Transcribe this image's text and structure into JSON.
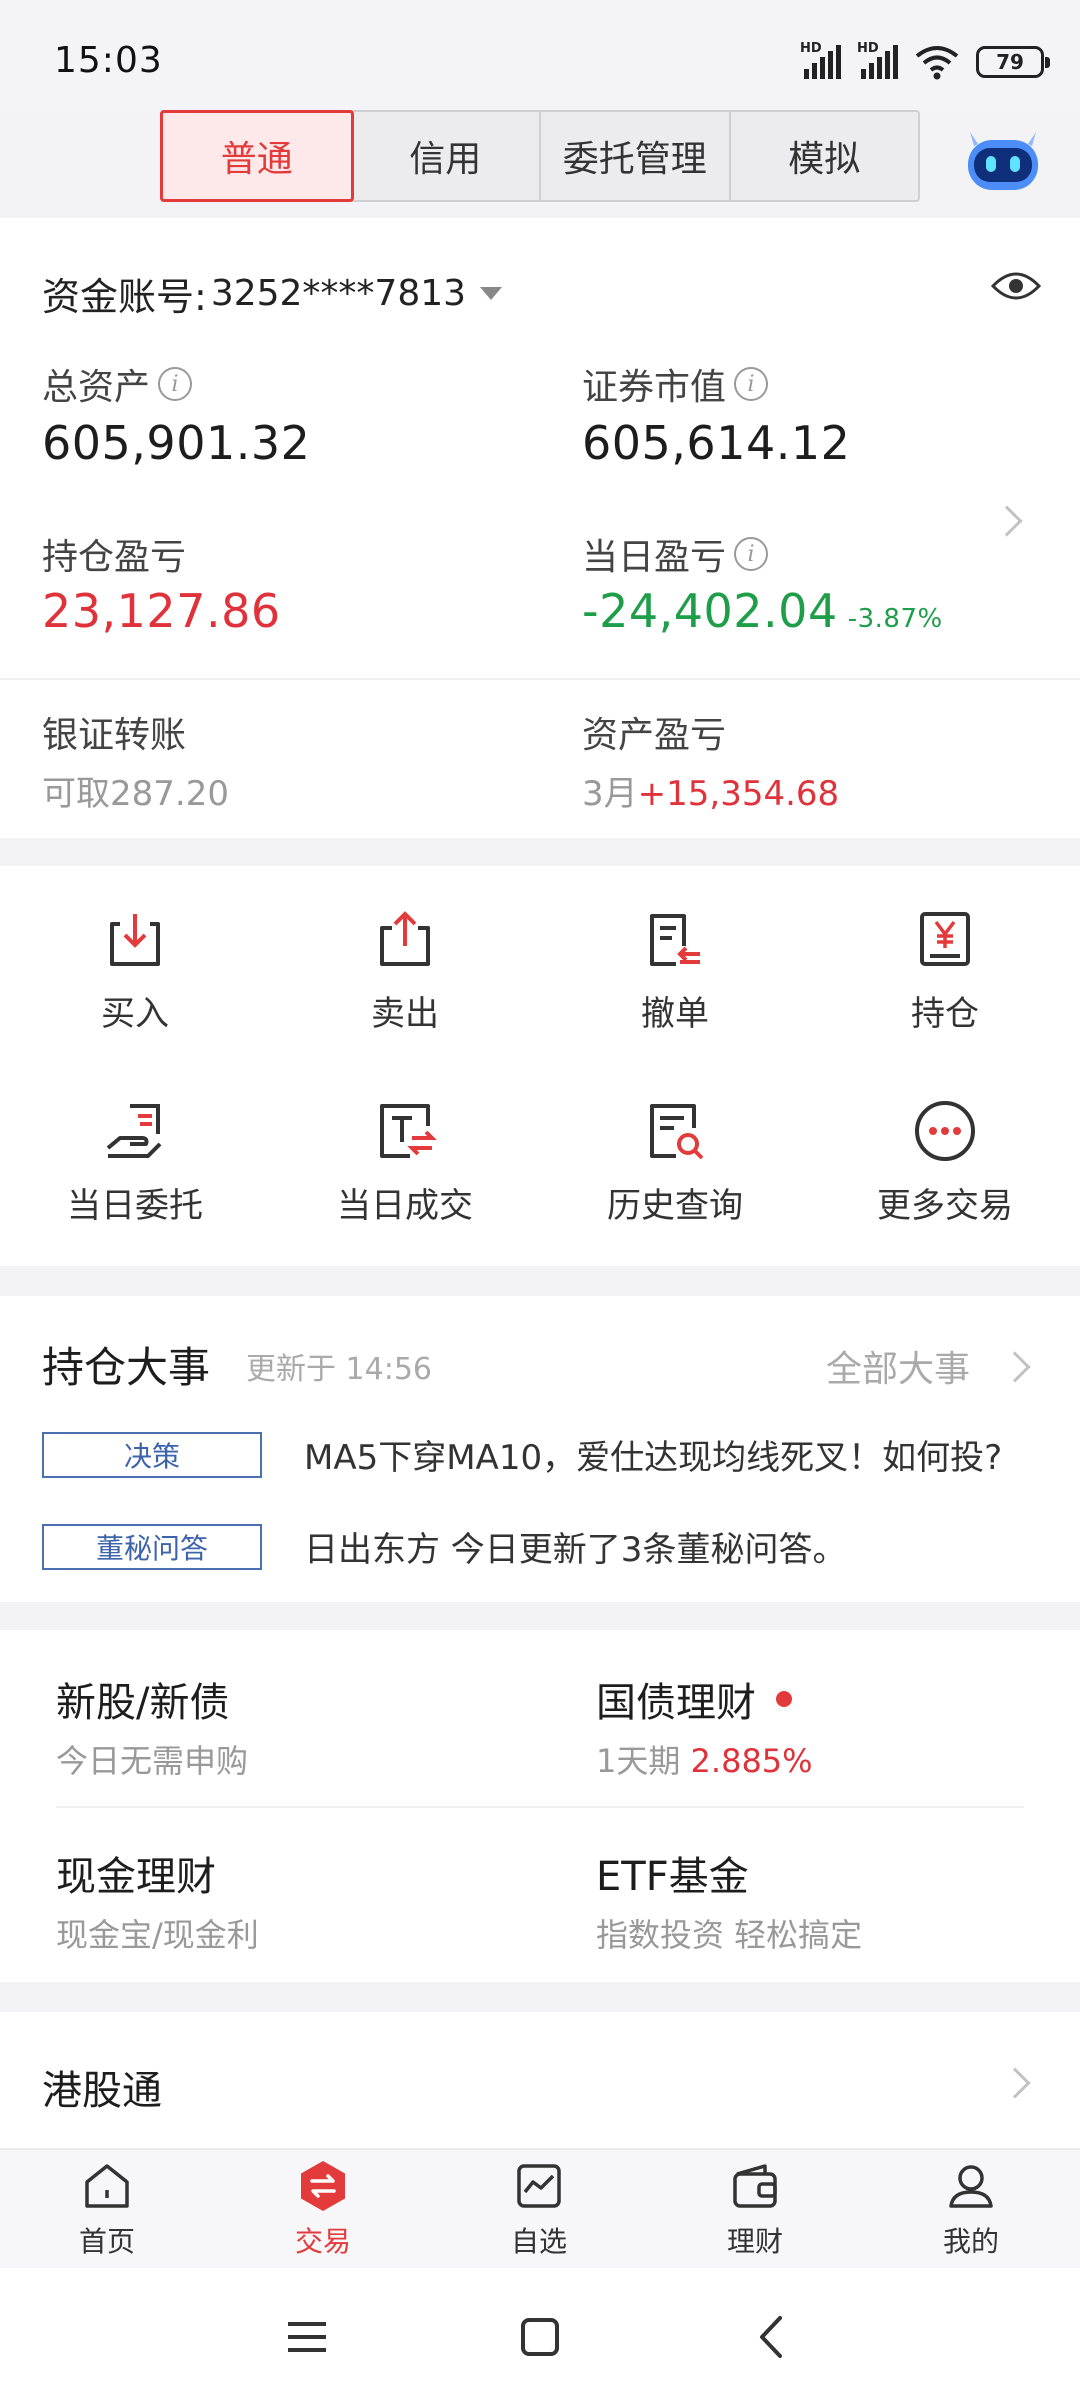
{
  "status": {
    "time": "15:03",
    "battery": "79",
    "hd": "HD"
  },
  "tabs": [
    "普通",
    "信用",
    "委托管理",
    "模拟"
  ],
  "account": {
    "label": "资金账号:",
    "number": "3252****7813",
    "total_assets_label": "总资产",
    "total_assets": "605,901.32",
    "market_value_label": "证券市值",
    "market_value": "605,614.12",
    "position_pl_label": "持仓盈亏",
    "position_pl": "23,127.86",
    "daily_pl_label": "当日盈亏",
    "daily_pl": "-24,402.04",
    "daily_pl_pct": "-3.87%",
    "transfer_label": "银证转账",
    "transfer_sub_prefix": "可取",
    "transfer_available": "287.20",
    "asset_pl_label": "资产盈亏",
    "asset_pl_month": "3月",
    "asset_pl_value": "+15,354.68",
    "info_glyph": "i"
  },
  "actions": [
    {
      "label": "买入",
      "icon": "buy-icon"
    },
    {
      "label": "卖出",
      "icon": "sell-icon"
    },
    {
      "label": "撤单",
      "icon": "cancel-order-icon"
    },
    {
      "label": "持仓",
      "icon": "position-icon"
    },
    {
      "label": "当日委托",
      "icon": "daily-order-icon"
    },
    {
      "label": "当日成交",
      "icon": "daily-deal-icon"
    },
    {
      "label": "历史查询",
      "icon": "history-search-icon"
    },
    {
      "label": "更多交易",
      "icon": "more-icon"
    }
  ],
  "events": {
    "title": "持仓大事",
    "updated": "更新于 14:56",
    "all": "全部大事",
    "items": [
      {
        "tag": "决策",
        "text": "MA5下穿MA10，爱仕达现均线死叉！如何投?"
      },
      {
        "tag": "董秘问答",
        "text": "日出东方 今日更新了3条董秘问答。"
      }
    ]
  },
  "services": {
    "ipo_title": "新股/新债",
    "ipo_sub": "今日无需申购",
    "bond_title": "国债理财",
    "bond_sub_prefix": "1天期",
    "bond_rate": "2.885%",
    "cash_title": "现金理财",
    "cash_sub": "现金宝/现金利",
    "etf_title": "ETF基金",
    "etf_sub": "指数投资 轻松搞定",
    "accent": "#e0323a"
  },
  "hk": {
    "title": "港股通"
  },
  "nav": [
    {
      "label": "首页",
      "icon": "home-icon"
    },
    {
      "label": "交易",
      "icon": "trade-icon"
    },
    {
      "label": "自选",
      "icon": "watchlist-icon"
    },
    {
      "label": "理财",
      "icon": "wallet-icon"
    },
    {
      "label": "我的",
      "icon": "profile-icon"
    }
  ]
}
